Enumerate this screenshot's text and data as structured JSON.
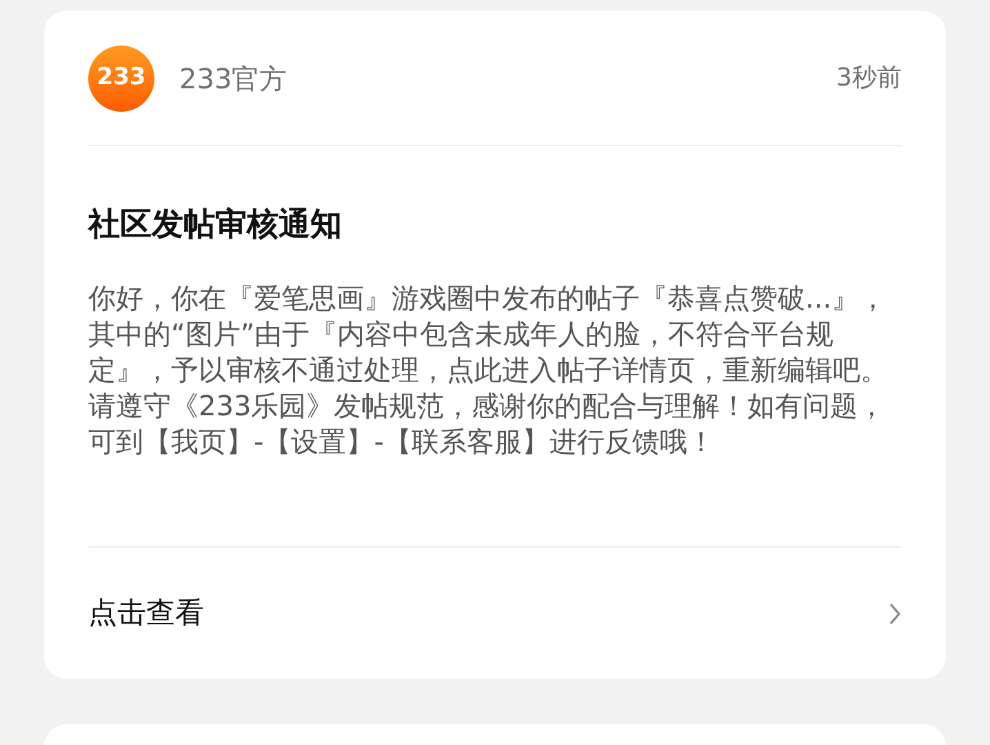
{
  "notice": {
    "sender": {
      "avatar_text": "233",
      "name": "233官方"
    },
    "time": "3秒前",
    "title": "社区发帖审核通知",
    "paragraphs": [
      "你好，你在『爱笔思画』游戏圈中发布的帖子『恭喜点赞破...』，其中的“图片”由于『内容中包含未成年人的脸，不符合平台规定』，予以审核不通过处理，点此进入帖子详情页，重新编辑吧。",
      "请遵守《233乐园》发帖规范，感谢你的配合与理解！如有问题，可到【我页】-【设置】-【联系客服】进行反馈哦！"
    ],
    "action": {
      "label": "点击查看"
    }
  }
}
